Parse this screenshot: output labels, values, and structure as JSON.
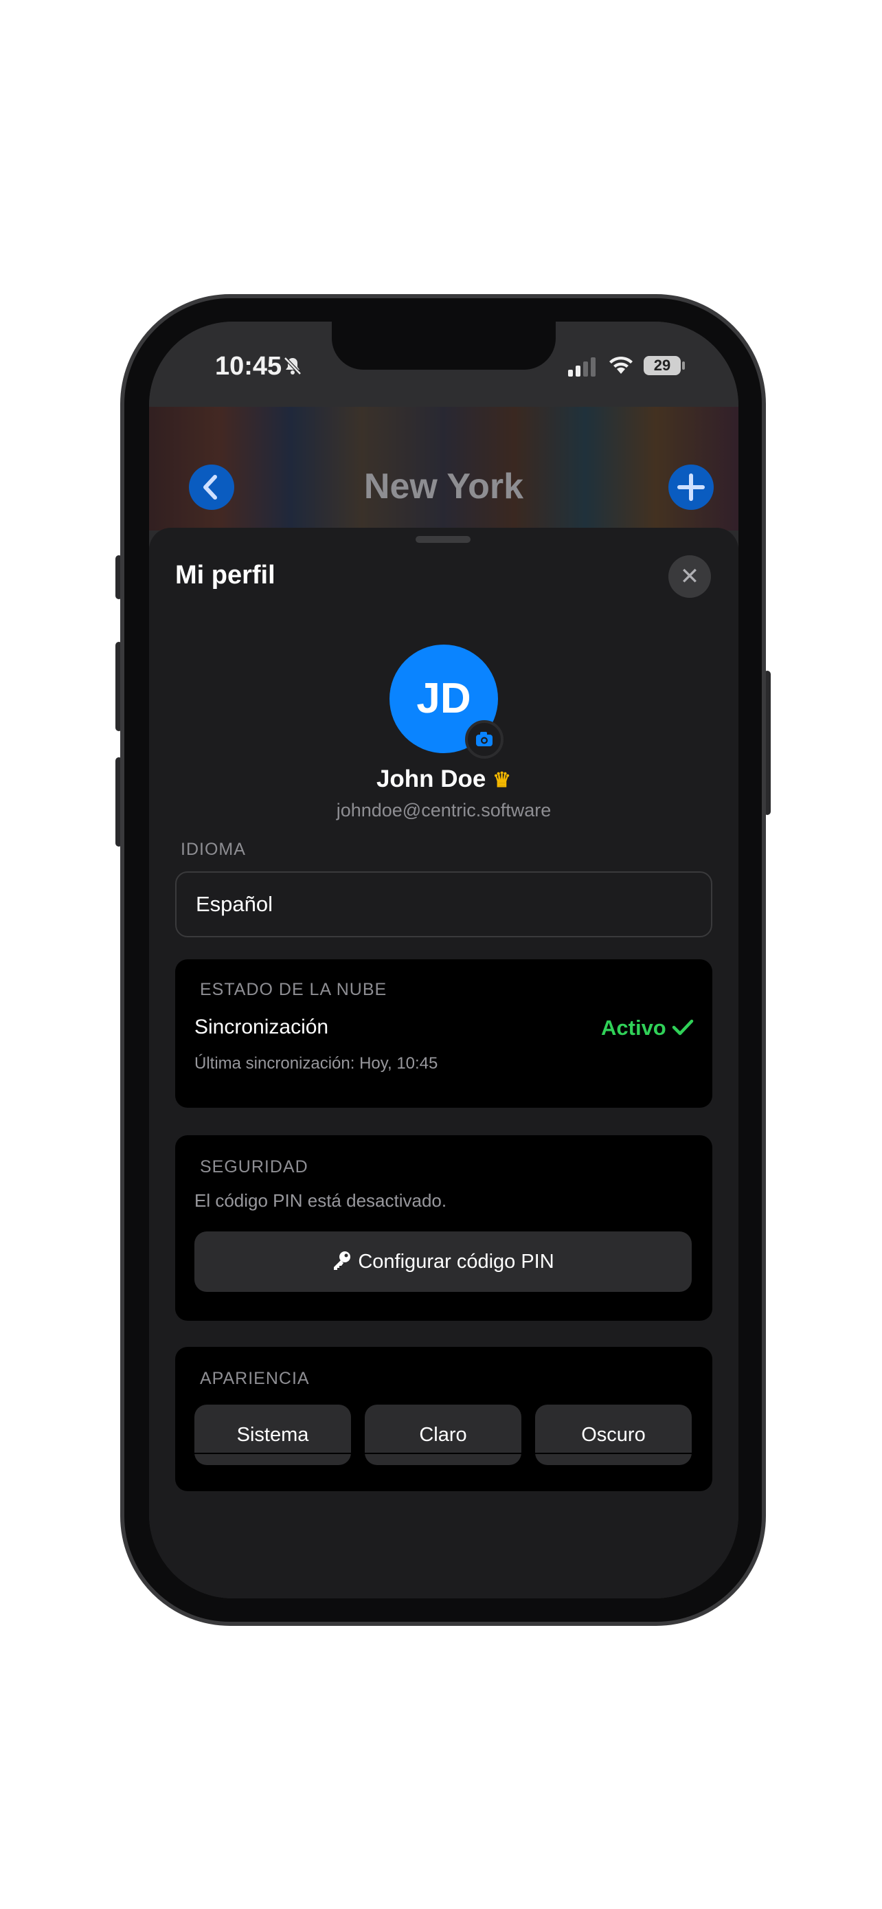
{
  "status_bar": {
    "time": "10:45",
    "battery": "29"
  },
  "header": {
    "city_title": "New York"
  },
  "sheet": {
    "title": "Mi perfil",
    "close_label": "✕"
  },
  "profile": {
    "initials": "JD",
    "name": "John Doe",
    "email": "johndoe@centric.software"
  },
  "language": {
    "label": "IDIOMA",
    "value": "Español"
  },
  "cloud": {
    "label": "ESTADO DE LA NUBE",
    "title": "Sincronización",
    "status": "Activo",
    "last_sync": "Última sincronización: Hoy, 10:45"
  },
  "security": {
    "label": "SEGURIDAD",
    "description": "El código PIN está desactivado.",
    "button_label": "Configurar código PIN"
  },
  "appearance": {
    "label": "APARIENCIA",
    "options": [
      "Sistema",
      "Claro",
      "Oscuro"
    ]
  },
  "colors": {
    "accent": "#0a84ff",
    "success": "#30d158",
    "crown": "#f5b800"
  },
  "icons": [
    "bell-slash-icon",
    "chevron-left-icon",
    "plus-icon",
    "close-icon",
    "camera-icon",
    "crown-icon",
    "checkmark-icon",
    "key-icon",
    "signal-icon",
    "wifi-icon",
    "battery-icon"
  ]
}
